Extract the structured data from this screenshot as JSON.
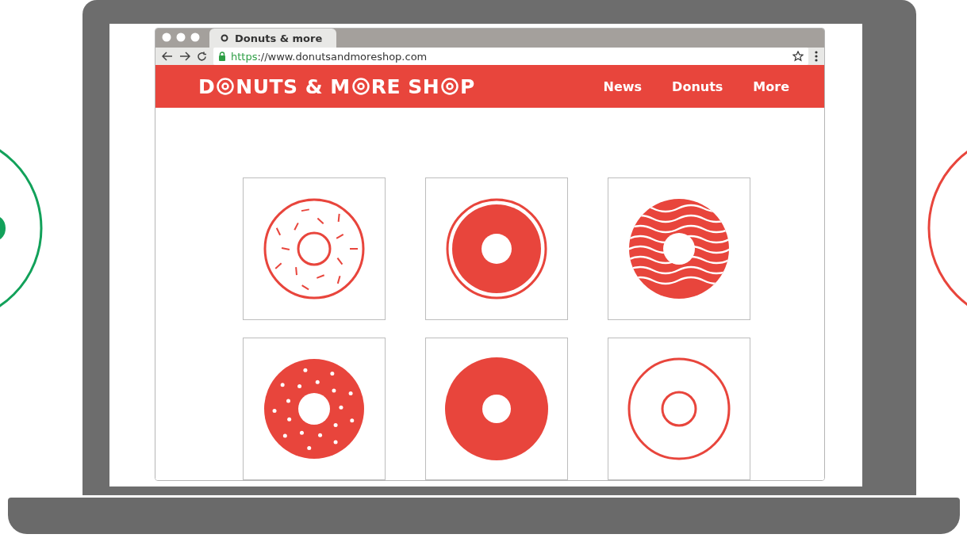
{
  "browser": {
    "tab_title": "Donuts & more",
    "url": {
      "scheme": "https",
      "rest": "://www.donutsandmoreshop.com"
    }
  },
  "site": {
    "logo_parts": [
      "D",
      "NUTS & M",
      "RE SH",
      "P"
    ],
    "nav": [
      "News",
      "Donuts",
      "More"
    ],
    "products": [
      {
        "kind": "sprinkles"
      },
      {
        "kind": "rimmed"
      },
      {
        "kind": "wavy"
      },
      {
        "kind": "dotted"
      },
      {
        "kind": "solid"
      },
      {
        "kind": "outline"
      }
    ]
  }
}
